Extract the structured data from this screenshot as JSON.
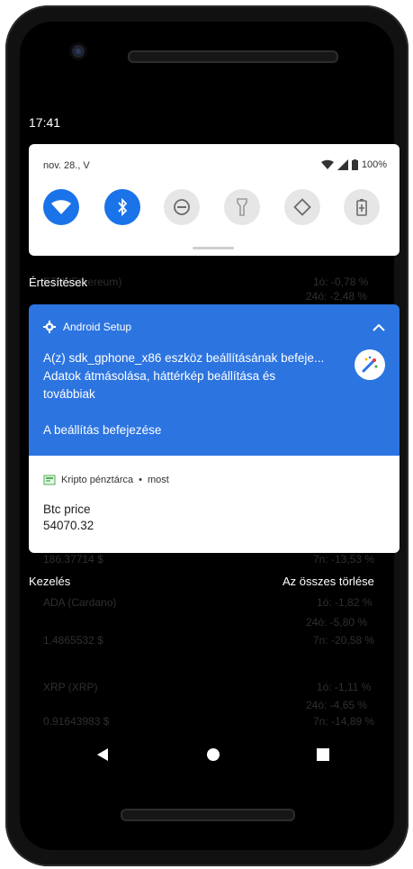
{
  "status": {
    "time": "17:41",
    "date": "nov. 28., V",
    "battery": "100%"
  },
  "background": {
    "eth_name": "ETH (Ethereum)",
    "eth_1h": "1ó: -0,78 %",
    "eth_24h": "24ó: -2,48 %",
    "eth_value_partial": "186.37714 $",
    "eth_7d": "7n: -13,53 %",
    "ada_name": "ADA (Cardano)",
    "ada_1h": "1ó: -1,82 %",
    "ada_24h": "24ó: -5,80 %",
    "ada_value": "1.4865532 $",
    "ada_7d": "7n: -20,58 %",
    "xrp_name": "XRP (XRP)",
    "xrp_1h": "1ó: -1,11 %",
    "xrp_24h": "24ó: -4,65 %",
    "xrp_value": "0.91643983 $",
    "xrp_7d": "7n: -14,89 %"
  },
  "notifications": {
    "section_label": "Értesítések",
    "manage": "Kezelés",
    "clear_all": "Az összes törlése",
    "setup": {
      "app_name": "Android Setup",
      "line1": "A(z) sdk_gphone_x86 eszköz beállításának befeje...",
      "line2": "Adatok átmásolása, háttérkép beállítása és",
      "line3": "továbbiak",
      "action": "A beállítás befejezése"
    },
    "wallet": {
      "app_name": "Kripto pénztárca",
      "time": "most",
      "title": "Btc price",
      "value": "54070.32"
    }
  },
  "colors": {
    "accent": "#2c74e0",
    "tile_active": "#1a73e8"
  },
  "icons": [
    "wifi-icon",
    "bluetooth-icon",
    "dnd-icon",
    "flashlight-icon",
    "auto-rotate-icon",
    "battery-saver-icon"
  ]
}
